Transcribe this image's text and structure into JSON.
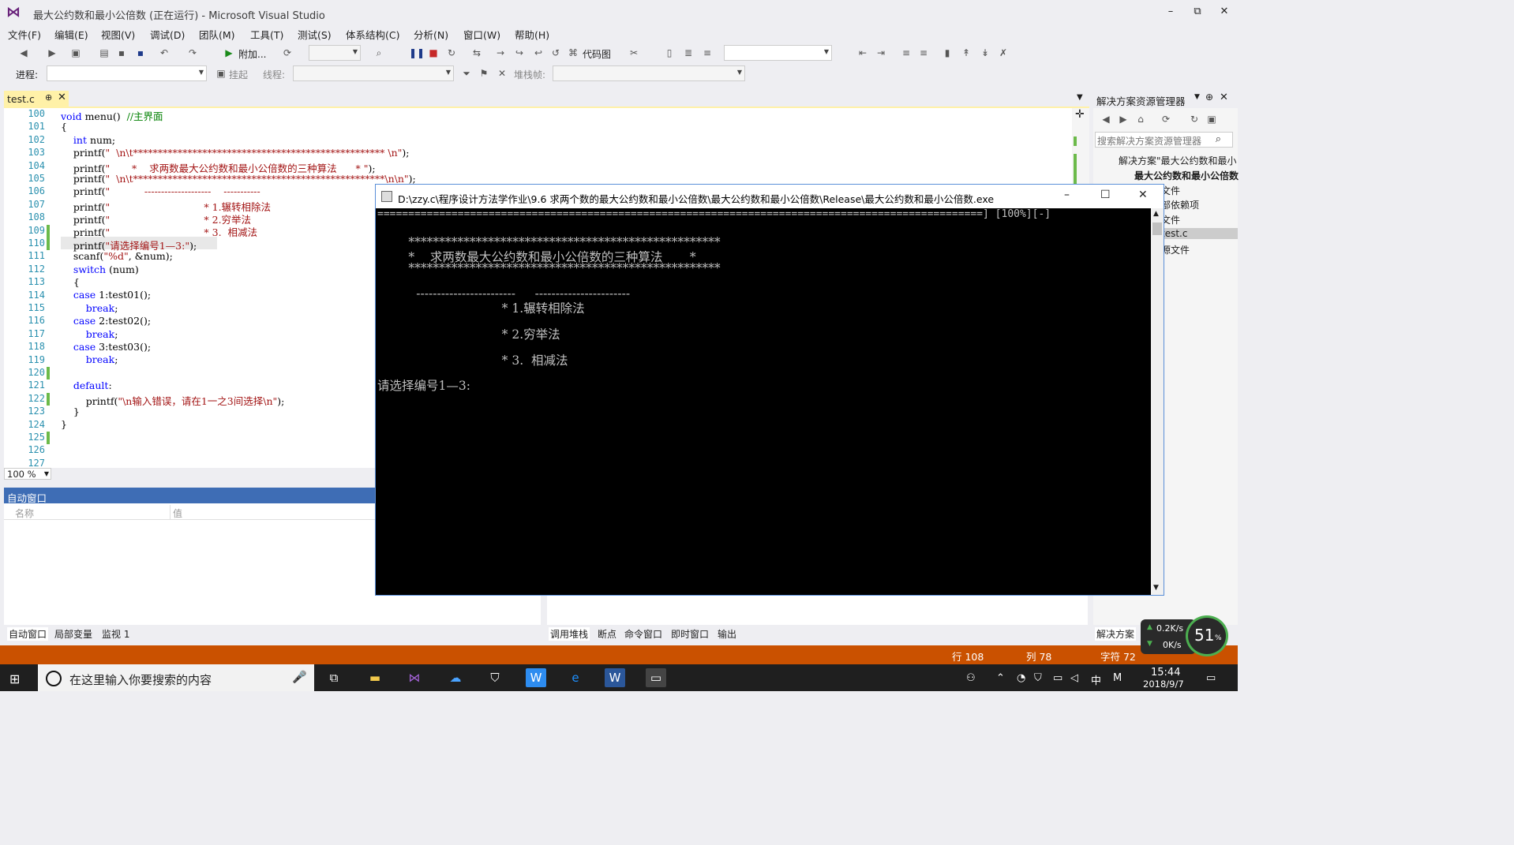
{
  "window": {
    "title": "最大公约数和最小公倍数 (正在运行) - Microsoft Visual Studio",
    "minimize": "–",
    "restore": "⧉",
    "close": "✕"
  },
  "menu": [
    "文件(F)",
    "编辑(E)",
    "视图(V)",
    "调试(D)",
    "团队(M)",
    "工具(T)",
    "测试(S)",
    "体系结构(C)",
    "分析(N)",
    "窗口(W)",
    "帮助(H)"
  ],
  "toolbar1": {
    "attach_label": "附加...",
    "codemap_label": "代码图"
  },
  "toolbar2": {
    "process_label": "进程:",
    "suspend_label": "挂起",
    "thread_label": "线程:",
    "stackframe_label": "堆栈帧:"
  },
  "editor": {
    "tab_name": "test.c",
    "zoom": "100 %",
    "line_numbers": [
      "100",
      "101",
      "102",
      "103",
      "104",
      "105",
      "106",
      "107",
      "108",
      "109",
      "110",
      "111",
      "112",
      "113",
      "114",
      "115",
      "116",
      "117",
      "118",
      "119",
      "120",
      "121",
      "122",
      "123",
      "124",
      "125",
      "126",
      "127"
    ]
  },
  "solution_explorer": {
    "title": "解决方案资源管理器",
    "search_placeholder": "搜索解决方案资源管理器",
    "items": [
      "解决方案\"最大公约数和最小",
      "最大公约数和最小公倍数",
      "文件",
      "部依赖项",
      "文件",
      "test.c",
      "源文件"
    ],
    "bottom_tab": "解决方案"
  },
  "auto_window": {
    "title": "自动窗口",
    "col_name": "名称",
    "col_value": "值",
    "tabs": [
      "自动窗口",
      "局部变量",
      "监视 1"
    ]
  },
  "debug_tabs": [
    "调用堆栈",
    "断点",
    "命令窗口",
    "即时窗口",
    "输出"
  ],
  "statusbar": {
    "line": "行 108",
    "col": "列 78",
    "char": "字符 72"
  },
  "console": {
    "title": "D:\\zzy.c\\程序设计方法学作业\\9.6 求两个数的最大公约数和最小公倍数\\最大公约数和最小公倍数\\Release\\最大公约数和最小公倍数.exe",
    "lines": [
      "==================================================================================================] [100%][-]",
      "",
      "        ***************************************************",
      "        *    求两数最大公约数和最小公倍数的三种算法       *",
      "        ***************************************************",
      "",
      "          ------------------------     -----------------------",
      "                                * 1.辗转相除法",
      "",
      "                                * 2.穷举法",
      "",
      "                                * 3.  相减法",
      "",
      "请选择编号1—3:"
    ]
  },
  "taskbar": {
    "search_placeholder": "在这里输入你要搜索的内容",
    "time": "15:44",
    "date": "2018/9/7",
    "ime": "中",
    "ime2": "M"
  },
  "network": {
    "up": "0.2K/s",
    "down": "0K/s",
    "percent": "51",
    "percent_unit": "%"
  },
  "colors": {
    "accent": "#ca5100",
    "tab_active": "#fff1a8",
    "panel_header": "#3e6db5"
  }
}
